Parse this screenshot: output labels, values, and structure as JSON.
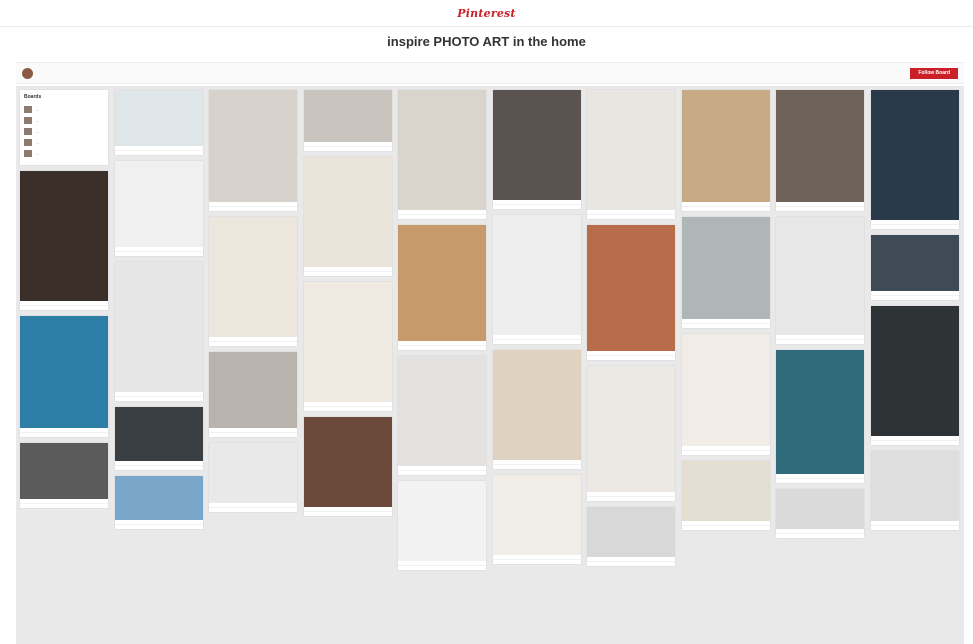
{
  "app": {
    "logo": "Pinterest"
  },
  "board": {
    "title": "inspire PHOTO ART in the home"
  },
  "owner": {
    "follow_label": "Follow Board"
  },
  "side_panel": {
    "title": "Boards",
    "items": [
      {
        "label": "..."
      },
      {
        "label": "..."
      },
      {
        "label": "..."
      },
      {
        "label": "..."
      },
      {
        "label": "..."
      }
    ]
  },
  "colors": {
    "accent": "#cb2027"
  },
  "columns": [
    {
      "pins": [
        {
          "img": "#3b2f2a",
          "h": 130
        },
        {
          "img": "#2e7fa8",
          "h": 112
        },
        {
          "img": "#5b5b5b",
          "h": 56
        }
      ]
    },
    {
      "pins": [
        {
          "img": "#dfe6e9",
          "h": 56
        },
        {
          "img": "#f0f0f0",
          "h": 86
        },
        {
          "img": "#e6e6e6",
          "h": 130
        },
        {
          "img": "#3a3f44",
          "h": 54
        },
        {
          "img": "#7aa6c9",
          "h": 44
        }
      ]
    },
    {
      "pins": [
        {
          "img": "#d8d2cc",
          "h": 112
        },
        {
          "img": "#ece6dc",
          "h": 120
        },
        {
          "img": "#b8b3ad",
          "h": 76
        },
        {
          "img": "#e9e9e9",
          "h": 60
        }
      ]
    },
    {
      "pins": [
        {
          "img": "#c9c4be",
          "h": 52
        },
        {
          "img": "#eae4da",
          "h": 110
        },
        {
          "img": "#efe9e1",
          "h": 120
        },
        {
          "img": "#6b4a3c",
          "h": 90
        }
      ]
    },
    {
      "pins": [
        {
          "img": "#d9d4cc",
          "h": 120
        },
        {
          "img": "#c79a6b",
          "h": 116
        },
        {
          "img": "#e4e2e0",
          "h": 110
        },
        {
          "img": "#f2f2f2",
          "h": 80
        }
      ]
    },
    {
      "pins": [
        {
          "img": "#5a534f",
          "h": 110
        },
        {
          "img": "#eeeeee",
          "h": 120
        },
        {
          "img": "#e0d2c0",
          "h": 110
        },
        {
          "img": "#f1ede7",
          "h": 80
        }
      ]
    },
    {
      "pins": [
        {
          "img": "#e9e6e1",
          "h": 120
        },
        {
          "img": "#b86d4a",
          "h": 126
        },
        {
          "img": "#ece9e4",
          "h": 126
        },
        {
          "img": "#d8d8d8",
          "h": 50
        }
      ]
    },
    {
      "pins": [
        {
          "img": "#c8ab86",
          "h": 112
        },
        {
          "img": "#aeb6b8",
          "h": 102
        },
        {
          "img": "#f1ece6",
          "h": 112
        },
        {
          "img": "#e4ddd2",
          "h": 60
        }
      ]
    },
    {
      "pins": [
        {
          "img": "#6e6259",
          "h": 112
        },
        {
          "img": "#e7e7e7",
          "h": 118
        },
        {
          "img": "#2f6a7a",
          "h": 124
        },
        {
          "img": "#dadada",
          "h": 40
        }
      ]
    },
    {
      "pins": [
        {
          "img": "#2a3a4a",
          "h": 130
        },
        {
          "img": "#3e4b57",
          "h": 56
        },
        {
          "img": "#2e3436",
          "h": 130
        },
        {
          "img": "#dedede",
          "h": 70
        }
      ]
    }
  ]
}
